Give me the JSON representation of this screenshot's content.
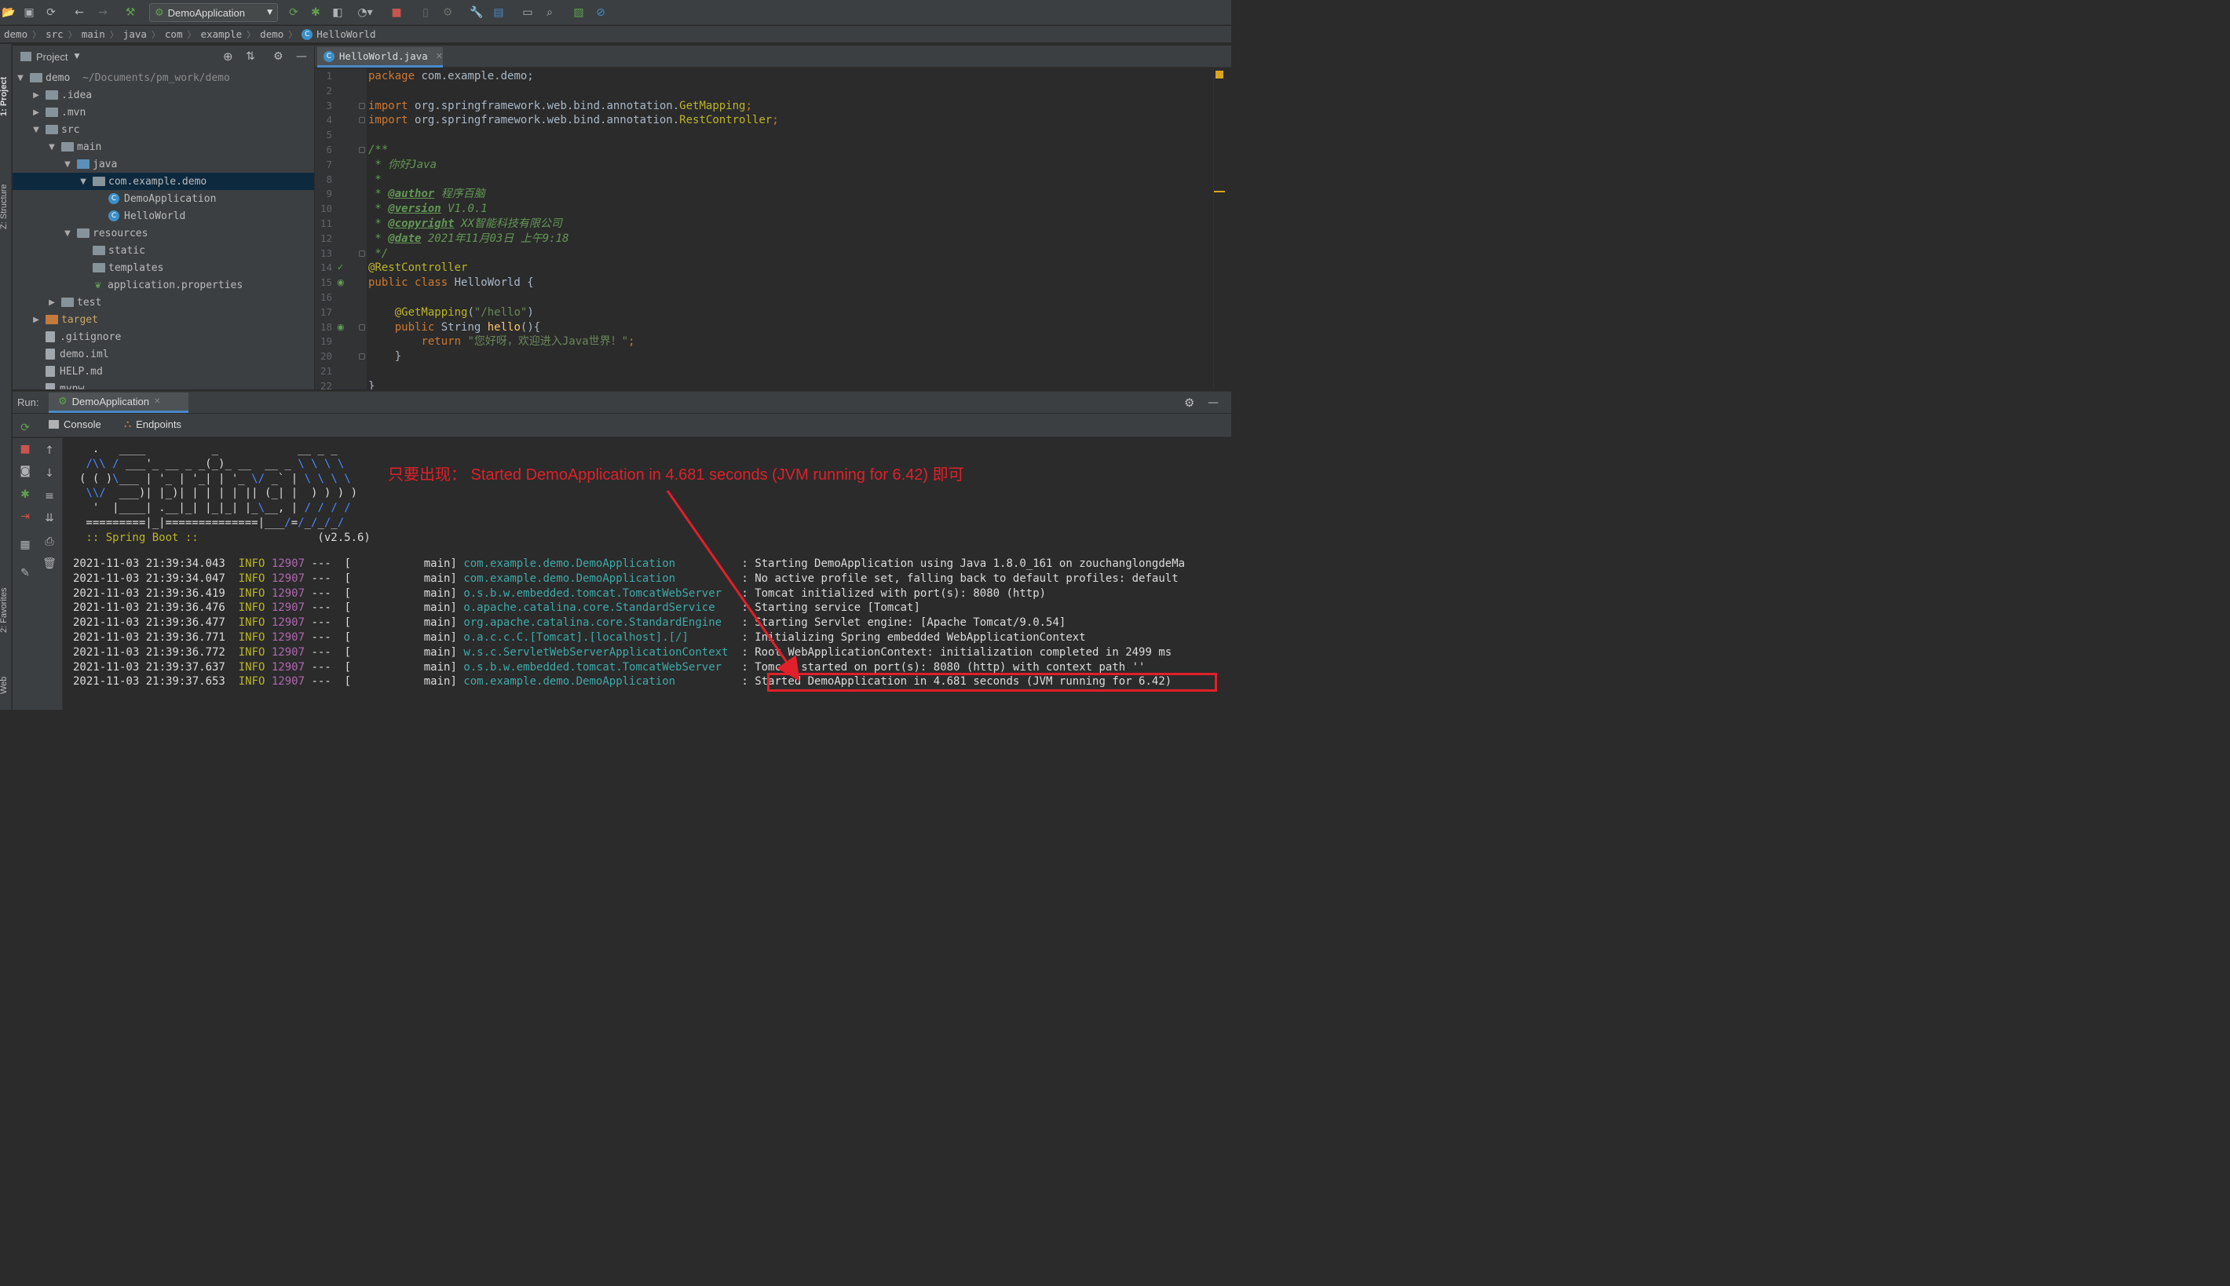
{
  "toolbar": {
    "run_config": "DemoApplication",
    "icons": [
      "open-folder-icon",
      "save-icon",
      "sync-icon",
      "back-icon",
      "forward-icon",
      "build-icon",
      "run-icon",
      "debug-icon",
      "coverage-icon",
      "profile-icon",
      "stop-icon",
      "settings-icon",
      "project-structure-icon",
      "search-icon"
    ]
  },
  "breadcrumb": [
    "demo",
    "src",
    "main",
    "java",
    "com",
    "example",
    "demo",
    "HelloWorld"
  ],
  "left_tools": {
    "project": "1: Project",
    "structure": "Z: Structure",
    "favorites": "2: Favorites",
    "web": "Web"
  },
  "project_panel": {
    "title": "Project",
    "tree": [
      {
        "label": "demo",
        "extra": "~/Documents/pm_work/demo",
        "depth": 0,
        "arrow": "▼",
        "icon": "folder"
      },
      {
        "label": ".idea",
        "depth": 1,
        "arrow": "▶",
        "icon": "folder"
      },
      {
        "label": ".mvn",
        "depth": 1,
        "arrow": "▶",
        "icon": "folder"
      },
      {
        "label": "src",
        "depth": 1,
        "arrow": "▼",
        "icon": "folder"
      },
      {
        "label": "main",
        "depth": 2,
        "arrow": "▼",
        "icon": "folder"
      },
      {
        "label": "java",
        "depth": 3,
        "arrow": "▼",
        "icon": "folder-blue"
      },
      {
        "label": "com.example.demo",
        "depth": 4,
        "arrow": "▼",
        "icon": "package",
        "selected": true
      },
      {
        "label": "DemoApplication",
        "depth": 5,
        "arrow": "",
        "icon": "class"
      },
      {
        "label": "HelloWorld",
        "depth": 5,
        "arrow": "",
        "icon": "class"
      },
      {
        "label": "resources",
        "depth": 3,
        "arrow": "▼",
        "icon": "folder"
      },
      {
        "label": "static",
        "depth": 4,
        "arrow": "",
        "icon": "folder"
      },
      {
        "label": "templates",
        "depth": 4,
        "arrow": "",
        "icon": "folder"
      },
      {
        "label": "application.properties",
        "depth": 4,
        "arrow": "",
        "icon": "leaf"
      },
      {
        "label": "test",
        "depth": 2,
        "arrow": "▶",
        "icon": "folder"
      },
      {
        "label": "target",
        "depth": 1,
        "arrow": "▶",
        "icon": "folder-orange"
      },
      {
        "label": ".gitignore",
        "depth": 1,
        "arrow": "",
        "icon": "file"
      },
      {
        "label": "demo.iml",
        "depth": 1,
        "arrow": "",
        "icon": "file"
      },
      {
        "label": "HELP.md",
        "depth": 1,
        "arrow": "",
        "icon": "file"
      },
      {
        "label": "mvnw",
        "depth": 1,
        "arrow": "",
        "icon": "file"
      }
    ]
  },
  "editor": {
    "tab": "HelloWorld.java",
    "lines": [
      [
        [
          "kw",
          "package "
        ],
        [
          "plain",
          "com.example.demo;"
        ]
      ],
      [],
      [
        [
          "kw",
          "import "
        ],
        [
          "plain",
          "org.springframework.web.bind.annotation."
        ],
        [
          "ann",
          "GetMapping"
        ],
        [
          "kw",
          ";"
        ]
      ],
      [
        [
          "kw",
          "import "
        ],
        [
          "plain",
          "org.springframework.web.bind.annotation."
        ],
        [
          "ann",
          "RestController"
        ],
        [
          "kw",
          ";"
        ]
      ],
      [],
      [
        [
          "doc",
          "/**"
        ]
      ],
      [
        [
          "doc",
          " * 你好Java"
        ]
      ],
      [
        [
          "doc",
          " *"
        ]
      ],
      [
        [
          "doc",
          " * "
        ],
        [
          "tag",
          "@author"
        ],
        [
          "doc",
          " 程序百脑"
        ]
      ],
      [
        [
          "doc",
          " * "
        ],
        [
          "tag",
          "@version"
        ],
        [
          "doc",
          " V1.0.1"
        ]
      ],
      [
        [
          "doc",
          " * "
        ],
        [
          "tag",
          "@copyright"
        ],
        [
          "doc",
          " XX智能科技有限公司"
        ]
      ],
      [
        [
          "doc",
          " * "
        ],
        [
          "tag",
          "@date"
        ],
        [
          "doc",
          " 2021年11月03日 上午9:18"
        ]
      ],
      [
        [
          "doc",
          " */"
        ]
      ],
      [
        [
          "ann",
          "@RestController"
        ]
      ],
      [
        [
          "kw",
          "public class "
        ],
        [
          "plain",
          "HelloWorld {"
        ]
      ],
      [],
      [
        [
          "plain",
          "    "
        ],
        [
          "ann",
          "@GetMapping"
        ],
        [
          "plain",
          "("
        ],
        [
          "str",
          "\"/hello\""
        ],
        [
          "plain",
          ")"
        ]
      ],
      [
        [
          "plain",
          "    "
        ],
        [
          "kw",
          "public "
        ],
        [
          "plain",
          "String "
        ],
        [
          "fn",
          "hello"
        ],
        [
          "plain",
          "(){"
        ]
      ],
      [
        [
          "plain",
          "        "
        ],
        [
          "kw",
          "return "
        ],
        [
          "str",
          "\"您好呀，欢迎进入Java世界！\""
        ],
        [
          "kw",
          ";"
        ]
      ],
      [
        [
          "plain",
          "    }"
        ]
      ],
      [],
      [
        [
          "plain",
          "}"
        ]
      ]
    ]
  },
  "run_panel": {
    "label": "Run:",
    "tab": "DemoApplication",
    "subtabs": {
      "console": "Console",
      "endpoints": "Endpoints"
    }
  },
  "console": {
    "banner": [
      "  .   ____          _            __ _ _",
      " /\\\\ / ___'_ __ _ _(_)_ __  __ _ \\ \\ \\ \\",
      "( ( )\\___ | '_ | '_| | '_ \\/ _` | \\ \\ \\ \\",
      " \\\\/  ___)| |_)| | | | | || (_| |  ) ) ) )",
      "  '  |____| .__|_| |_|_| |_\\__, | / / / /",
      " =========|_|==============|___/=/_/_/_/"
    ],
    "boot_label": " :: Spring Boot ::",
    "boot_version": "(v2.5.6)",
    "logs": [
      {
        "ts": "2021-11-03 21:39:34.043",
        "lvl": "INFO",
        "pid": "12907",
        "thread": "---  [           main]",
        "logger": "com.example.demo.DemoApplication",
        "msg": "Starting DemoApplication using Java 1.8.0_161 on zouchanglongdeMa"
      },
      {
        "ts": "2021-11-03 21:39:34.047",
        "lvl": "INFO",
        "pid": "12907",
        "thread": "---  [           main]",
        "logger": "com.example.demo.DemoApplication",
        "msg": "No active profile set, falling back to default profiles: default"
      },
      {
        "ts": "2021-11-03 21:39:36.419",
        "lvl": "INFO",
        "pid": "12907",
        "thread": "---  [           main]",
        "logger": "o.s.b.w.embedded.tomcat.TomcatWebServer",
        "msg": "Tomcat initialized with port(s): 8080 (http)"
      },
      {
        "ts": "2021-11-03 21:39:36.476",
        "lvl": "INFO",
        "pid": "12907",
        "thread": "---  [           main]",
        "logger": "o.apache.catalina.core.StandardService",
        "msg": "Starting service [Tomcat]"
      },
      {
        "ts": "2021-11-03 21:39:36.477",
        "lvl": "INFO",
        "pid": "12907",
        "thread": "---  [           main]",
        "logger": "org.apache.catalina.core.StandardEngine",
        "msg": "Starting Servlet engine: [Apache Tomcat/9.0.54]"
      },
      {
        "ts": "2021-11-03 21:39:36.771",
        "lvl": "INFO",
        "pid": "12907",
        "thread": "---  [           main]",
        "logger": "o.a.c.c.C.[Tomcat].[localhost].[/]",
        "msg": "Initializing Spring embedded WebApplicationContext"
      },
      {
        "ts": "2021-11-03 21:39:36.772",
        "lvl": "INFO",
        "pid": "12907",
        "thread": "---  [           main]",
        "logger": "w.s.c.ServletWebServerApplicationContext",
        "msg": "Root WebApplicationContext: initialization completed in 2499 ms"
      },
      {
        "ts": "2021-11-03 21:39:37.637",
        "lvl": "INFO",
        "pid": "12907",
        "thread": "---  [           main]",
        "logger": "o.s.b.w.embedded.tomcat.TomcatWebServer",
        "msg": "Tomcat started on port(s): 8080 (http) with context path ''"
      },
      {
        "ts": "2021-11-03 21:39:37.653",
        "lvl": "INFO",
        "pid": "12907",
        "thread": "---  [           main]",
        "logger": "com.example.demo.DemoApplication",
        "msg": "Started DemoApplication in 4.681 seconds (JVM running for 6.42)"
      }
    ]
  },
  "annotation": {
    "note": "只要出现： Started DemoApplication in 4.681 seconds (JVM running for 6.42) 即可",
    "color": "#e0202a"
  }
}
